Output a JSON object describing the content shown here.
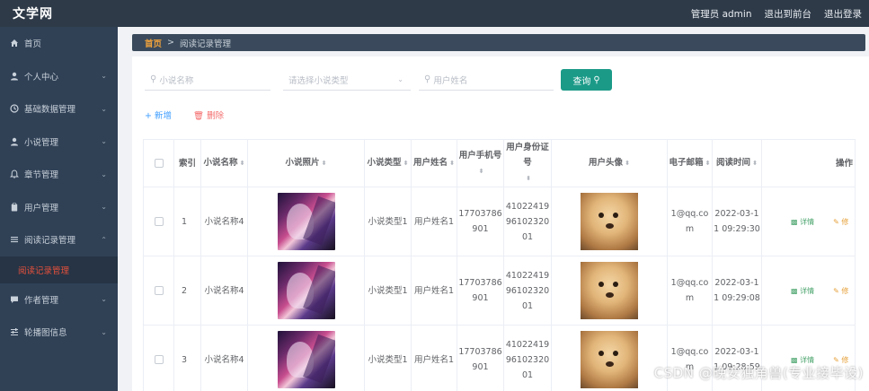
{
  "header": {
    "brand": "文学网",
    "admin_label": "管理员 admin",
    "exit_front": "退出到前台",
    "logout": "退出登录"
  },
  "sidebar": {
    "items": [
      {
        "label": "首页",
        "icon": "home-icon"
      },
      {
        "label": "个人中心",
        "icon": "user-icon"
      },
      {
        "label": "基础数据管理",
        "icon": "clock-icon"
      },
      {
        "label": "小说管理",
        "icon": "user-icon"
      },
      {
        "label": "章节管理",
        "icon": "bell-icon"
      },
      {
        "label": "用户管理",
        "icon": "clipboard-icon"
      },
      {
        "label": "阅读记录管理",
        "icon": "list-icon"
      },
      {
        "label": "作者管理",
        "icon": "chat-icon"
      },
      {
        "label": "轮播图信息",
        "icon": "sliders-icon"
      }
    ],
    "active_sub": "阅读记录管理"
  },
  "breadcrumb": {
    "home": "首页",
    "sep": ">",
    "current": "阅读记录管理"
  },
  "search": {
    "novel_name_placeholder": "小说名称",
    "novel_type_placeholder": "请选择小说类型",
    "user_name_placeholder": "用户姓名",
    "query_label": "查询"
  },
  "actions": {
    "add_label": "新增",
    "delete_label": "删除"
  },
  "table": {
    "headers": {
      "index": "索引",
      "novel_name": "小说名称",
      "novel_photo": "小说照片",
      "novel_type": "小说类型",
      "user_name": "用户姓名",
      "user_phone": "用户手机号",
      "user_id_card": "用户身份证号",
      "user_avatar": "用户头像",
      "email": "电子邮箱",
      "read_time": "阅读时间",
      "ops": "操作"
    },
    "rows": [
      {
        "index": "1",
        "novel_name": "小说名称4",
        "novel_type": "小说类型1",
        "user_name": "用户姓名1",
        "phone": "17703786901",
        "id_card": "410224199610232001",
        "email": "1@qq.com",
        "read_time": "2022-03-11 09:29:30",
        "detail": "详情",
        "edit": "修"
      },
      {
        "index": "2",
        "novel_name": "小说名称4",
        "novel_type": "小说类型1",
        "user_name": "用户姓名1",
        "phone": "17703786901",
        "id_card": "410224199610232001",
        "email": "1@qq.com",
        "read_time": "2022-03-11 09:29:08",
        "detail": "详情",
        "edit": "修"
      },
      {
        "index": "3",
        "novel_name": "小说名称4",
        "novel_type": "小说类型1",
        "user_name": "用户姓名1",
        "phone": "17703786901",
        "id_card": "410224199610232001",
        "email": "1@qq.com",
        "read_time": "2022-03-11 09:28:59",
        "detail": "详情",
        "edit": "修"
      }
    ]
  },
  "watermark": "CSDN @晚安独角兽(专业接毕设)"
}
